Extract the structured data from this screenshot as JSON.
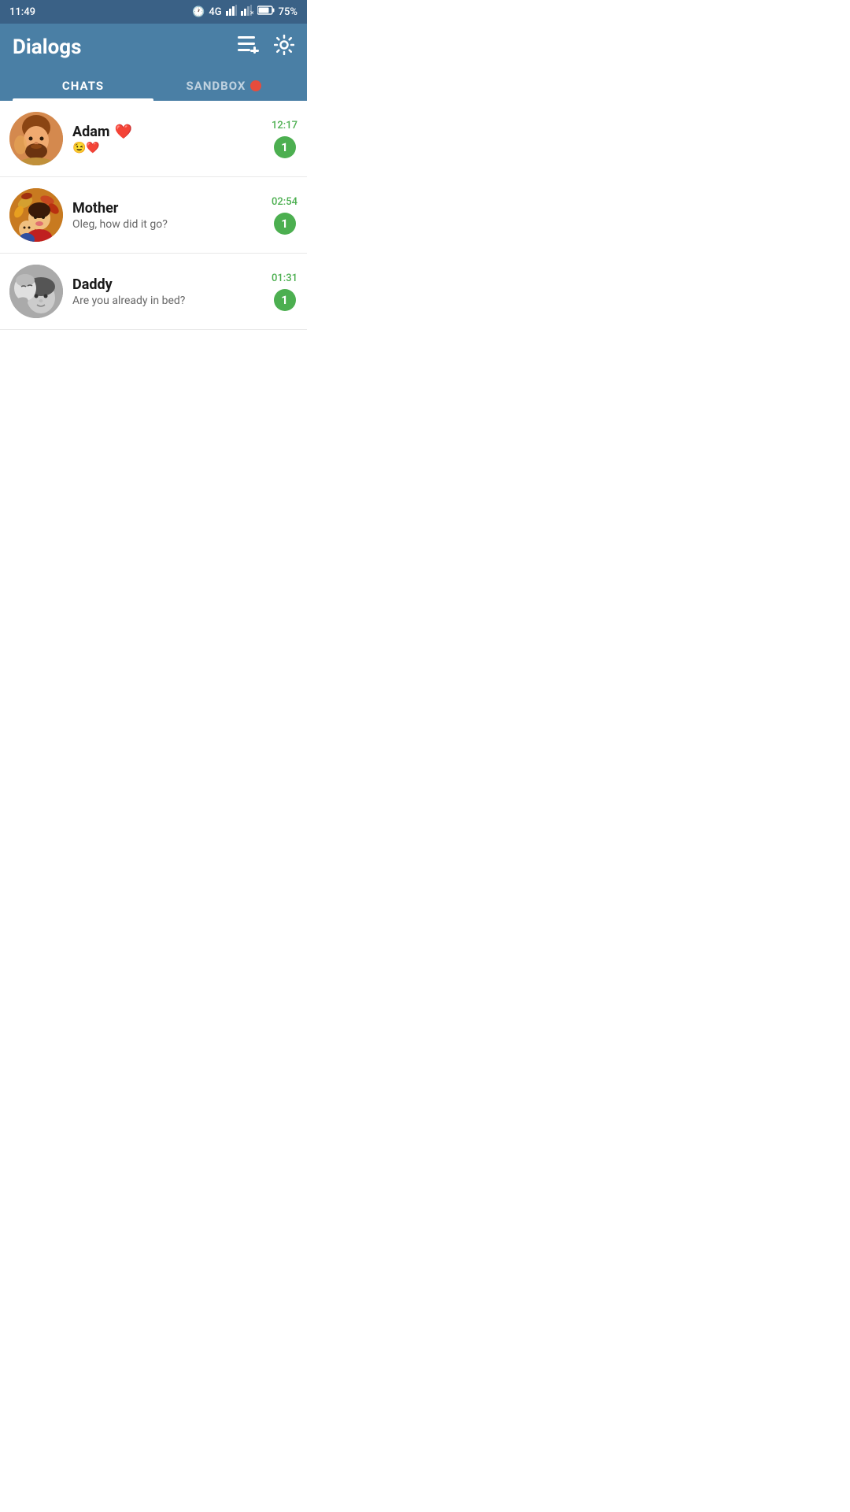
{
  "statusBar": {
    "time": "11:49",
    "network": "4G",
    "battery": "75%"
  },
  "header": {
    "title": "Dialogs",
    "newChatIcon": "≡+",
    "settingsIcon": "⚙"
  },
  "tabs": [
    {
      "id": "chats",
      "label": "CHATS",
      "active": true
    },
    {
      "id": "sandbox",
      "label": "SANDBOX",
      "active": false,
      "hasDot": true
    }
  ],
  "chats": [
    {
      "id": "adam",
      "name": "Adam",
      "nameEmoji": "❤️",
      "preview": "😉❤️",
      "time": "12:17",
      "unread": 1,
      "avatarColor": "#c87030"
    },
    {
      "id": "mother",
      "name": "Mother",
      "preview": "Oleg, how did it go?",
      "time": "02:54",
      "unread": 1,
      "avatarColor": "#c87a20"
    },
    {
      "id": "daddy",
      "name": "Daddy",
      "preview": "Are you already in bed?",
      "time": "01:31",
      "unread": 1,
      "avatarColor": "#888888"
    }
  ]
}
